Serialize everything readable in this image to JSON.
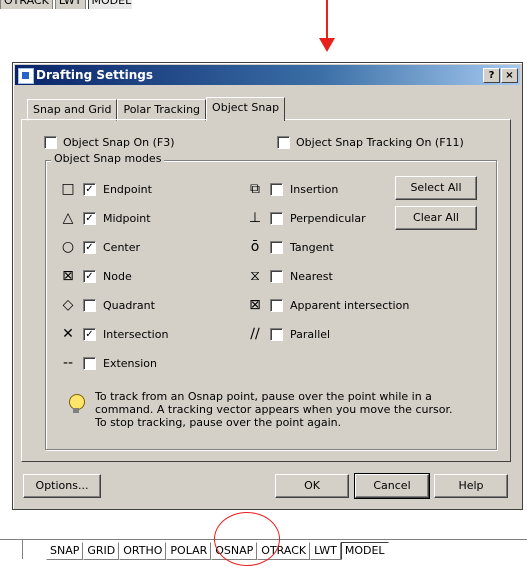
{
  "top_strip": {
    "buttons": [
      "OTRACK",
      "LWT",
      "MODEL"
    ]
  },
  "dialog": {
    "title": "Drafting Settings",
    "help_btn": "?",
    "close_btn": "×",
    "tabs": [
      "Snap and Grid",
      "Polar Tracking",
      "Object Snap"
    ],
    "active_tab": "Object Snap",
    "object_snap_on": {
      "label": "Object Snap On (F3)",
      "checked": false
    },
    "object_snap_tracking_on": {
      "label": "Object Snap Tracking On (F11)",
      "checked": false
    },
    "group_label": "Object Snap modes",
    "left_modes": [
      {
        "label": "Endpoint",
        "checked": true,
        "symbol": "□"
      },
      {
        "label": "Midpoint",
        "checked": true,
        "symbol": "△"
      },
      {
        "label": "Center",
        "checked": true,
        "symbol": "○"
      },
      {
        "label": "Node",
        "checked": true,
        "symbol": "⊠"
      },
      {
        "label": "Quadrant",
        "checked": false,
        "symbol": "◇"
      },
      {
        "label": "Intersection",
        "checked": true,
        "symbol": "✕"
      },
      {
        "label": "Extension",
        "checked": false,
        "symbol": "--"
      }
    ],
    "right_modes": [
      {
        "label": "Insertion",
        "checked": false,
        "symbol": "⧉"
      },
      {
        "label": "Perpendicular",
        "checked": false,
        "symbol": "⊥"
      },
      {
        "label": "Tangent",
        "checked": false,
        "symbol": "ō"
      },
      {
        "label": "Nearest",
        "checked": false,
        "symbol": "⧖"
      },
      {
        "label": "Apparent intersection",
        "checked": false,
        "symbol": "⊠"
      },
      {
        "label": "Parallel",
        "checked": false,
        "symbol": "∕∕"
      }
    ],
    "select_all": "Select All",
    "clear_all": "Clear All",
    "tip": "To track from an Osnap point, pause over the point while in a command.  A tracking vector appears when you move the cursor. To stop tracking, pause over the point again.",
    "options_btn": "Options...",
    "ok_btn": "OK",
    "cancel_btn": "Cancel",
    "help_button": "Help"
  },
  "status_bar": {
    "buttons": [
      "SNAP",
      "GRID",
      "ORTHO",
      "POLAR",
      "OSNAP",
      "OTRACK",
      "LWT",
      "MODEL"
    ],
    "pressed": "MODEL"
  },
  "colors": {
    "annotation": "#e8201c",
    "dialog_bg": "#d4d0c8",
    "title_bar": "#0a246a"
  }
}
